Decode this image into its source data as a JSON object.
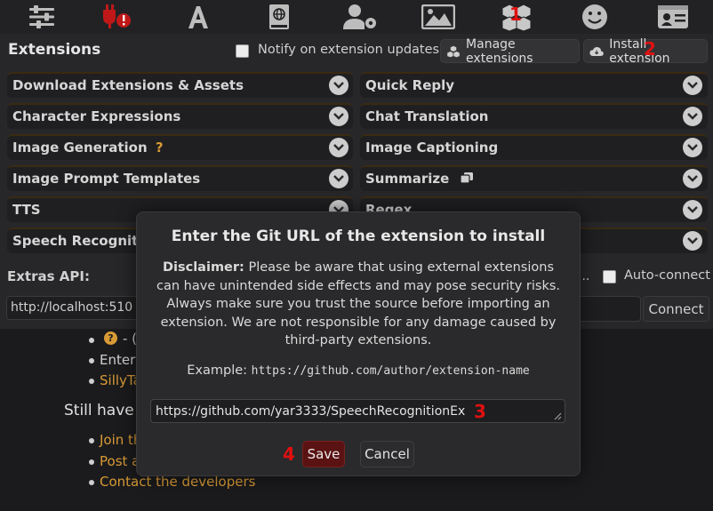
{
  "top_icons": [
    "sliders-icon",
    "plug-warning-icon",
    "font-a-icon",
    "book-globe-icon",
    "user-gear-icon",
    "landscape-image-icon",
    "cubes-icon",
    "smile-icon",
    "id-card-icon"
  ],
  "extensions": {
    "title": "Extensions",
    "notify_label": "Notify on extension updates",
    "manage_label": "Manage extensions",
    "install_label": "Install extension"
  },
  "drawers_left": [
    "Download Extensions & Assets",
    "Character Expressions",
    "Image Generation",
    "Image Prompt Templates",
    "TTS",
    "Speech Recognition"
  ],
  "drawers_right": [
    "Quick Reply",
    "Chat Translation",
    "Image Captioning",
    "Summarize",
    "Regex",
    ""
  ],
  "image_generation_help": "?",
  "extras": {
    "label": "Extras API:",
    "url_value": "http://localhost:510",
    "auto_connect_label": "Auto-connect",
    "ellipsis": "...",
    "connect_label": "Connect"
  },
  "below": {
    "line1_tail": "- (",
    "line2": "Enter",
    "line3": "SillyTa",
    "heading": "Still have",
    "link1": "Join th",
    "link2": "Post a",
    "link3": "Contact the developers"
  },
  "modal": {
    "title": "Enter the Git URL of the extension to install",
    "disclaimer_bold": "Disclaimer:",
    "disclaimer_text": "Please be aware that using external extensions can have unintended side effects and may pose security risks. Always make sure you trust the source before importing an extension. We are not responsible for any damage caused by third-party extensions.",
    "example_label": "Example:",
    "example_url": "https://github.com/author/extension-name",
    "input_value": "https://github.com/yar3333/SpeechRecognitionEx",
    "save_label": "Save",
    "cancel_label": "Cancel"
  },
  "annotations": {
    "a1": "1",
    "a2": "2",
    "a3": "3",
    "a4": "4"
  },
  "colors": {
    "accent_link": "#d89a35",
    "annotation": "#e01010",
    "save_bg": "#5a1212"
  }
}
